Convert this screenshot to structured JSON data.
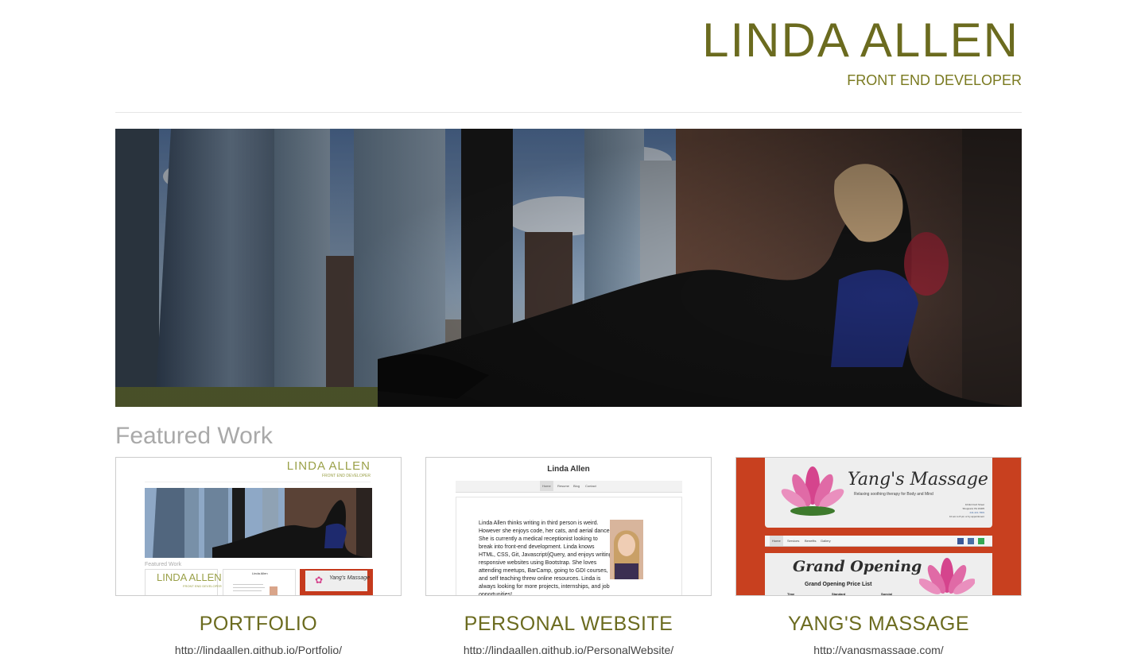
{
  "header": {
    "title": "LINDA ALLEN",
    "subtitle": "FRONT END DEVELOPER"
  },
  "hero": {
    "alt": "Linda sitting on a window ledge overlooking skyscrapers"
  },
  "featured": {
    "heading": "Featured Work",
    "items": [
      {
        "title": "PORTFOLIO",
        "url": "http://lindaallen.github.io/Portfolio/",
        "thumb": {
          "site_title": "LINDA ALLEN",
          "site_subtitle": "FRONT END DEVELOPER",
          "section": "Featured Work",
          "mini1_title": "LINDA ALLEN",
          "mini1_sub": "FRONT END DEVELOPER",
          "mini2_title": "Linda Allen",
          "mini3_title": "Yang's Massage"
        }
      },
      {
        "title": "PERSONAL WEBSITE",
        "url": "http://lindaallen.github.io/PersonalWebsite/",
        "thumb": {
          "name": "Linda Allen",
          "nav": [
            "Home",
            "Resume",
            "Blog",
            "Contact"
          ],
          "bio": "Linda Allen thinks writing in third person is weird. However she enjoys code, her cats, and aerial dance. She is currently a medical receptionist looking to break into front-end development. Linda knows HTML, CSS, Git, Javascript/jQuery, and enjoys writing responsive websites using Bootstrap. She loves attending meetups, BarCamp, going to GDI courses, and self teaching threw online resources. Linda is always looking for more projects, internships, and job opportunities!"
        }
      },
      {
        "title": "YANG'S MASSAGE",
        "url": "http://yangsmassage.com/",
        "thumb": {
          "brand": "Yang's Massage",
          "tagline": "Relaxing soothing therapy for Body and Mind",
          "address_line1": "1011A Ford Street",
          "address_line2": "Sheppard, PA 19405",
          "phone": "444-421-7809",
          "hours": "10 am to 8 pm or by appointment",
          "nav": [
            "Home",
            "Services",
            "Benefits",
            "Gallery"
          ],
          "promo_title": "Grand Opening",
          "price_list": "Grand Opening Price List",
          "columns": [
            "Time",
            "Standard",
            "Special"
          ]
        }
      }
    ]
  },
  "colors": {
    "accent": "#6b6b1f",
    "muted_heading": "#a9a9a9",
    "yang_red": "#c8401f",
    "lotus_pink": "#d5448d"
  }
}
